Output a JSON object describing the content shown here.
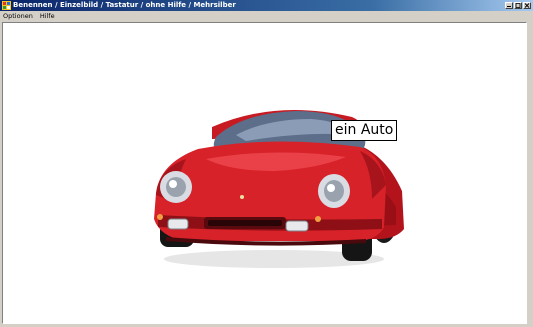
{
  "window": {
    "title": "Benennen / Einzelbild / Tastatur / ohne Hilfe / Mehrsilber"
  },
  "menu": {
    "items": [
      {
        "label": "Optionen"
      },
      {
        "label": "Hilfe"
      }
    ]
  },
  "content": {
    "image_label": "ein Auto",
    "image_subject": "red sports car"
  },
  "colors": {
    "titlebar_start": "#0a246a",
    "titlebar_end": "#a6caf0",
    "car_body": "#d8222a"
  }
}
